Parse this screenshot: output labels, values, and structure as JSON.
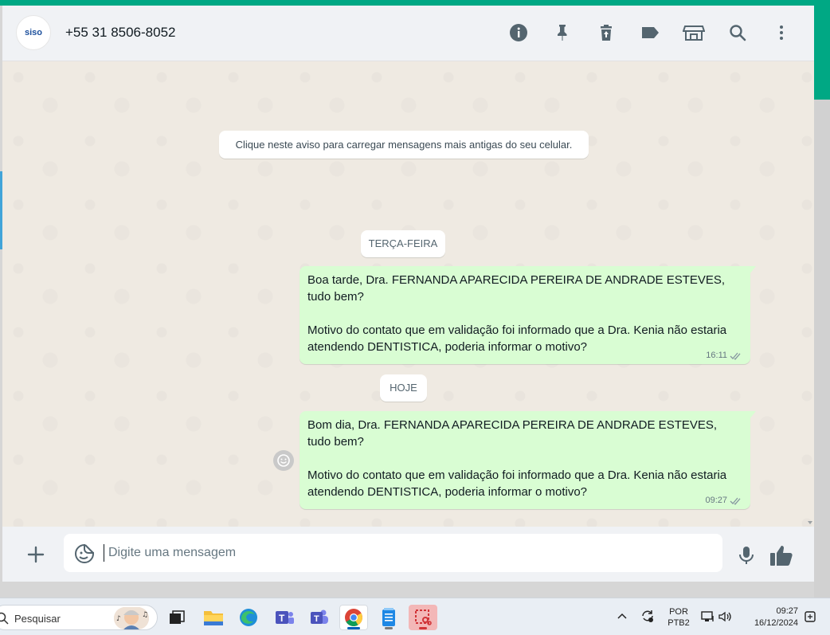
{
  "header": {
    "avatar_text": "siso",
    "contact_name": "+55 31 8506-8052",
    "icons": [
      "info-icon",
      "pin-icon",
      "delete-icon",
      "label-icon",
      "store-icon",
      "search-icon",
      "menu-icon"
    ]
  },
  "chat": {
    "notice": "Clique neste aviso para carregar mensagens mais antigas do seu celular.",
    "date_chips": [
      "TERÇA-FEIRA",
      "HOJE"
    ],
    "messages": [
      {
        "text": "Boa tarde, Dra. FERNANDA APARECIDA PEREIRA DE ANDRADE ESTEVES, tudo bem?\n\nMotivo do contato que em validação foi informado que a Dra. Kenia não estaria atendendo DENTISTICA, poderia informar o motivo?",
        "time": "16:11",
        "status": "double-check-icon"
      },
      {
        "text": "Bom dia, Dra. FERNANDA APARECIDA PEREIRA DE ANDRADE ESTEVES, tudo bem?\n\nMotivo do contato que em validação foi informado que a Dra. Kenia não estaria atendendo DENTISTICA, poderia informar o motivo?",
        "time": "09:27",
        "status": "double-check-icon"
      }
    ]
  },
  "composer": {
    "placeholder": "Digite uma mensagem",
    "value": ""
  },
  "taskbar": {
    "search_label": "Pesquisar",
    "apps": [
      "task-view-icon",
      "file-explorer-icon",
      "edge-icon",
      "teams-classic-icon",
      "teams-icon",
      "chrome-icon",
      "notepad-icon",
      "snipping-tool-icon"
    ],
    "lang_line1": "POR",
    "lang_line2": "PTB2",
    "time": "09:27",
    "date": "16/12/2024"
  },
  "colors": {
    "accent": "#00a884",
    "bubble_out": "#d9fdd3",
    "chat_bg": "#efeae2",
    "header_bg": "#f0f2f5"
  }
}
